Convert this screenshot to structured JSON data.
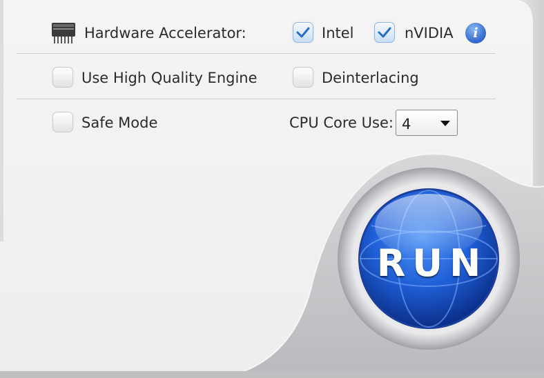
{
  "hardware_accelerator": {
    "label": "Hardware Accelerator:",
    "icon": "chip-icon",
    "intel": {
      "label": "Intel",
      "checked": true
    },
    "nvidia": {
      "label": "nVIDIA",
      "checked": true
    },
    "info_icon": "info-icon",
    "info_glyph": "i"
  },
  "options": {
    "high_quality": {
      "label": "Use High Quality Engine",
      "checked": false
    },
    "deinterlacing": {
      "label": "Deinterlacing",
      "checked": false
    },
    "safe_mode": {
      "label": "Safe Mode",
      "checked": false
    }
  },
  "cpu_core": {
    "label": "CPU Core Use:",
    "value": "4",
    "icon": "chevron-down-icon"
  },
  "run_button": {
    "label": "RUN"
  },
  "colors": {
    "panel": "#f1f1f1",
    "run_blue": "#1f5fd6",
    "check_blue": "#2a6cc2"
  }
}
